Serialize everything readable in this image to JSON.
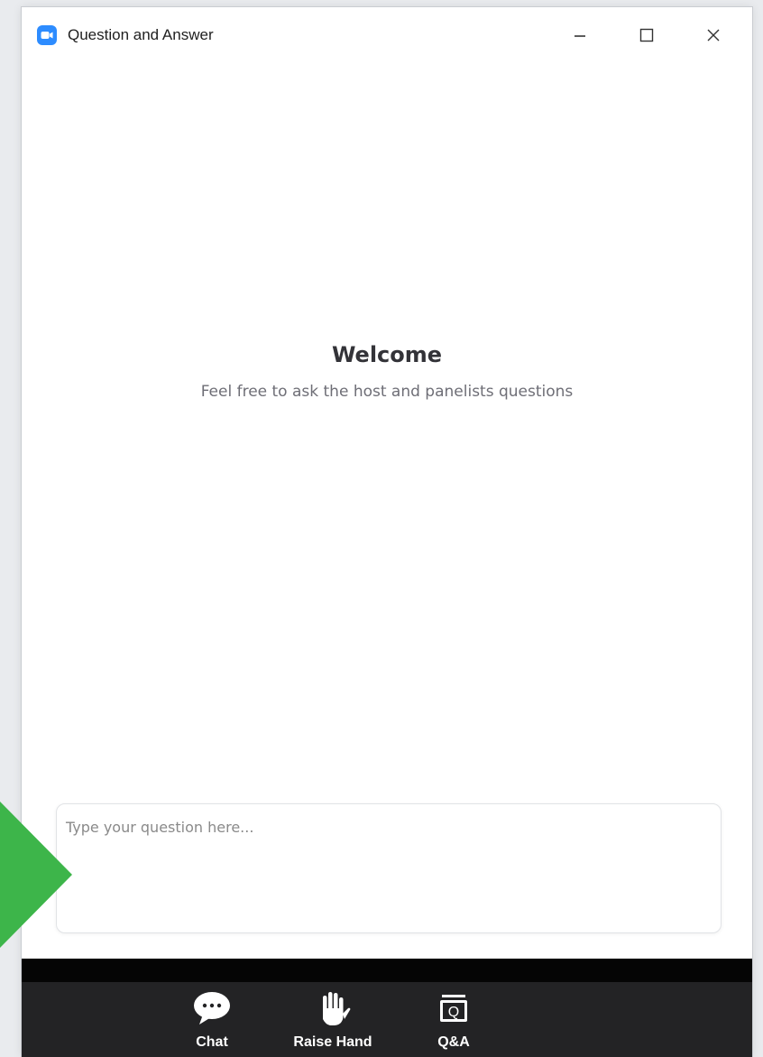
{
  "window": {
    "title": "Question and Answer",
    "controls": {
      "minimize": "minimize-icon",
      "maximize": "maximize-icon",
      "close": "close-icon"
    }
  },
  "welcome": {
    "heading": "Welcome",
    "subtitle": "Feel free to ask the host and panelists questions"
  },
  "question_input": {
    "value": "",
    "placeholder": "Type your question here..."
  },
  "toolbar": {
    "items": [
      {
        "label": "Chat",
        "icon": "chat-bubble-icon"
      },
      {
        "label": "Raise Hand",
        "icon": "raise-hand-icon"
      },
      {
        "label": "Q&A",
        "icon": "qa-icon"
      }
    ]
  },
  "colors": {
    "app_icon_blue": "#2d8cff",
    "toolbar_bg": "#232325",
    "toolbar_edge": "#050505",
    "arrow_green": "#3db54a",
    "heading_text": "#333338",
    "subtitle_text": "#6e6e76"
  }
}
